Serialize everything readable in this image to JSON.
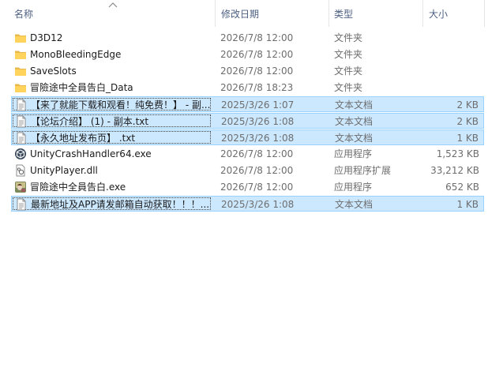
{
  "columns": {
    "name": "名称",
    "modified": "修改日期",
    "type": "类型",
    "size": "大小"
  },
  "files": [
    {
      "name": "D3D12",
      "modified": "2026/7/8 12:00",
      "type": "文件夹",
      "size": "",
      "icon": "folder-icon",
      "selected": false
    },
    {
      "name": "MonoBleedingEdge",
      "modified": "2026/7/8 12:00",
      "type": "文件夹",
      "size": "",
      "icon": "folder-icon",
      "selected": false
    },
    {
      "name": "SaveSlots",
      "modified": "2026/7/8 12:00",
      "type": "文件夹",
      "size": "",
      "icon": "folder-icon",
      "selected": false
    },
    {
      "name": "冒險途中全員告白_Data",
      "modified": "2026/7/8 18:23",
      "type": "文件夹",
      "size": "",
      "icon": "folder-icon",
      "selected": false
    },
    {
      "name": "【来了就能下载和观看！纯免费！】 - 副...",
      "modified": "2025/3/26 1:07",
      "type": "文本文档",
      "size": "2 KB",
      "icon": "text-file-icon",
      "selected": true
    },
    {
      "name": "【论坛介绍】 (1) - 副本.txt",
      "modified": "2025/3/26 1:08",
      "type": "文本文档",
      "size": "2 KB",
      "icon": "text-file-icon",
      "selected": true
    },
    {
      "name": "【永久地址发布页】 .txt",
      "modified": "2025/3/26 1:08",
      "type": "文本文档",
      "size": "1 KB",
      "icon": "text-file-icon",
      "selected": true
    },
    {
      "name": "UnityCrashHandler64.exe",
      "modified": "2026/7/8 12:00",
      "type": "应用程序",
      "size": "1,523 KB",
      "icon": "unity-exe-icon",
      "selected": false
    },
    {
      "name": "UnityPlayer.dll",
      "modified": "2026/7/8 12:00",
      "type": "应用程序扩展",
      "size": "33,212 KB",
      "icon": "dll-file-icon",
      "selected": false
    },
    {
      "name": "冒險途中全員告白.exe",
      "modified": "2026/7/8 12:00",
      "type": "应用程序",
      "size": "652 KB",
      "icon": "game-exe-icon",
      "selected": false
    },
    {
      "name": "最新地址及APP请发邮箱自动获取！！！...",
      "modified": "2025/3/26 1:08",
      "type": "文本文档",
      "size": "1 KB",
      "icon": "text-file-icon",
      "selected": true
    }
  ]
}
